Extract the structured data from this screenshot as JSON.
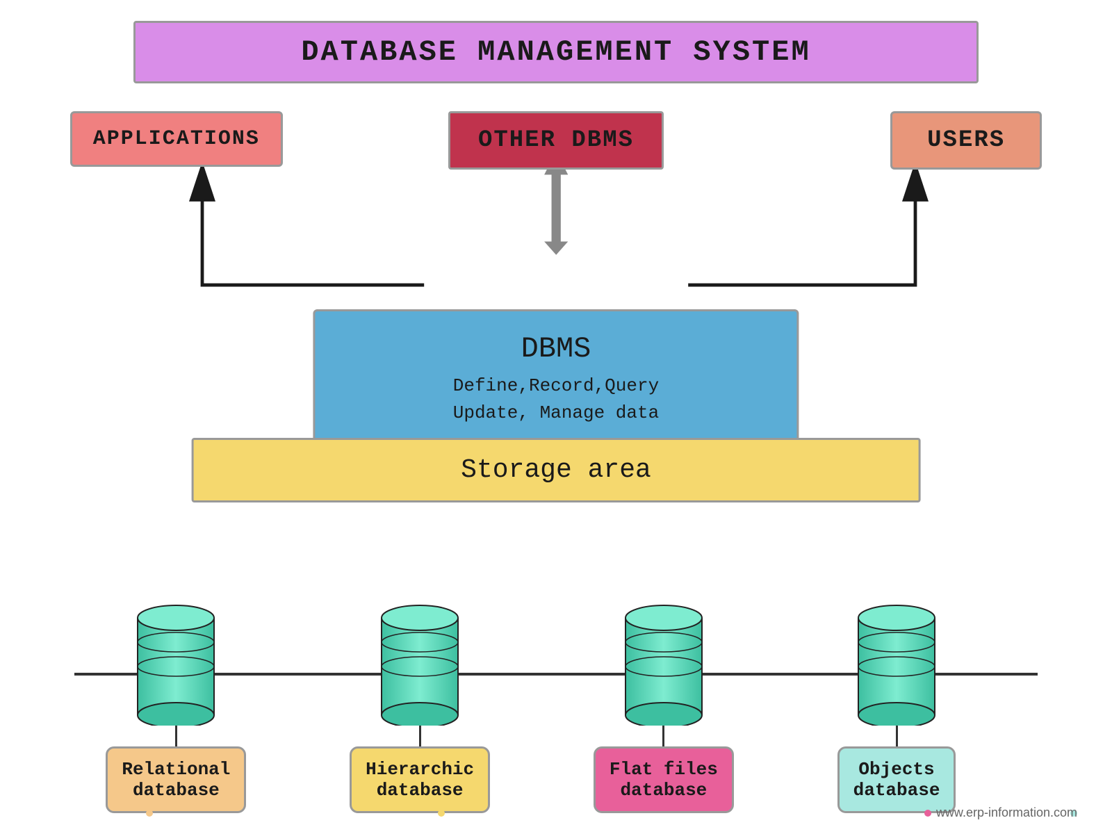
{
  "title": "DATABASE MANAGEMENT SYSTEM",
  "boxes": {
    "applications": "APPLICATIONS",
    "other_dbms": "OTHER DBMS",
    "users": "USERS",
    "dbms_title": "DBMS",
    "dbms_subtitle": "Define,Record,Query\nUpdate, Manage data",
    "storage": "Storage area"
  },
  "databases": [
    {
      "label_line1": "Relational",
      "label_line2": "database",
      "color_class": "db-label-relational"
    },
    {
      "label_line1": "Hierarchic",
      "label_line2": "database",
      "color_class": "db-label-hierarchic"
    },
    {
      "label_line1": "Flat files",
      "label_line2": "database",
      "color_class": "db-label-flatfiles"
    },
    {
      "label_line1": "Objects",
      "label_line2": "database",
      "color_class": "db-label-objects"
    }
  ],
  "watermark": "www.erp-information.com",
  "colors": {
    "title_bg": "#d98de8",
    "applications_bg": "#f08080",
    "other_dbms_bg": "#c0334d",
    "users_bg": "#e8967a",
    "dbms_bg": "#5badd6",
    "storage_bg": "#f5d86e"
  }
}
